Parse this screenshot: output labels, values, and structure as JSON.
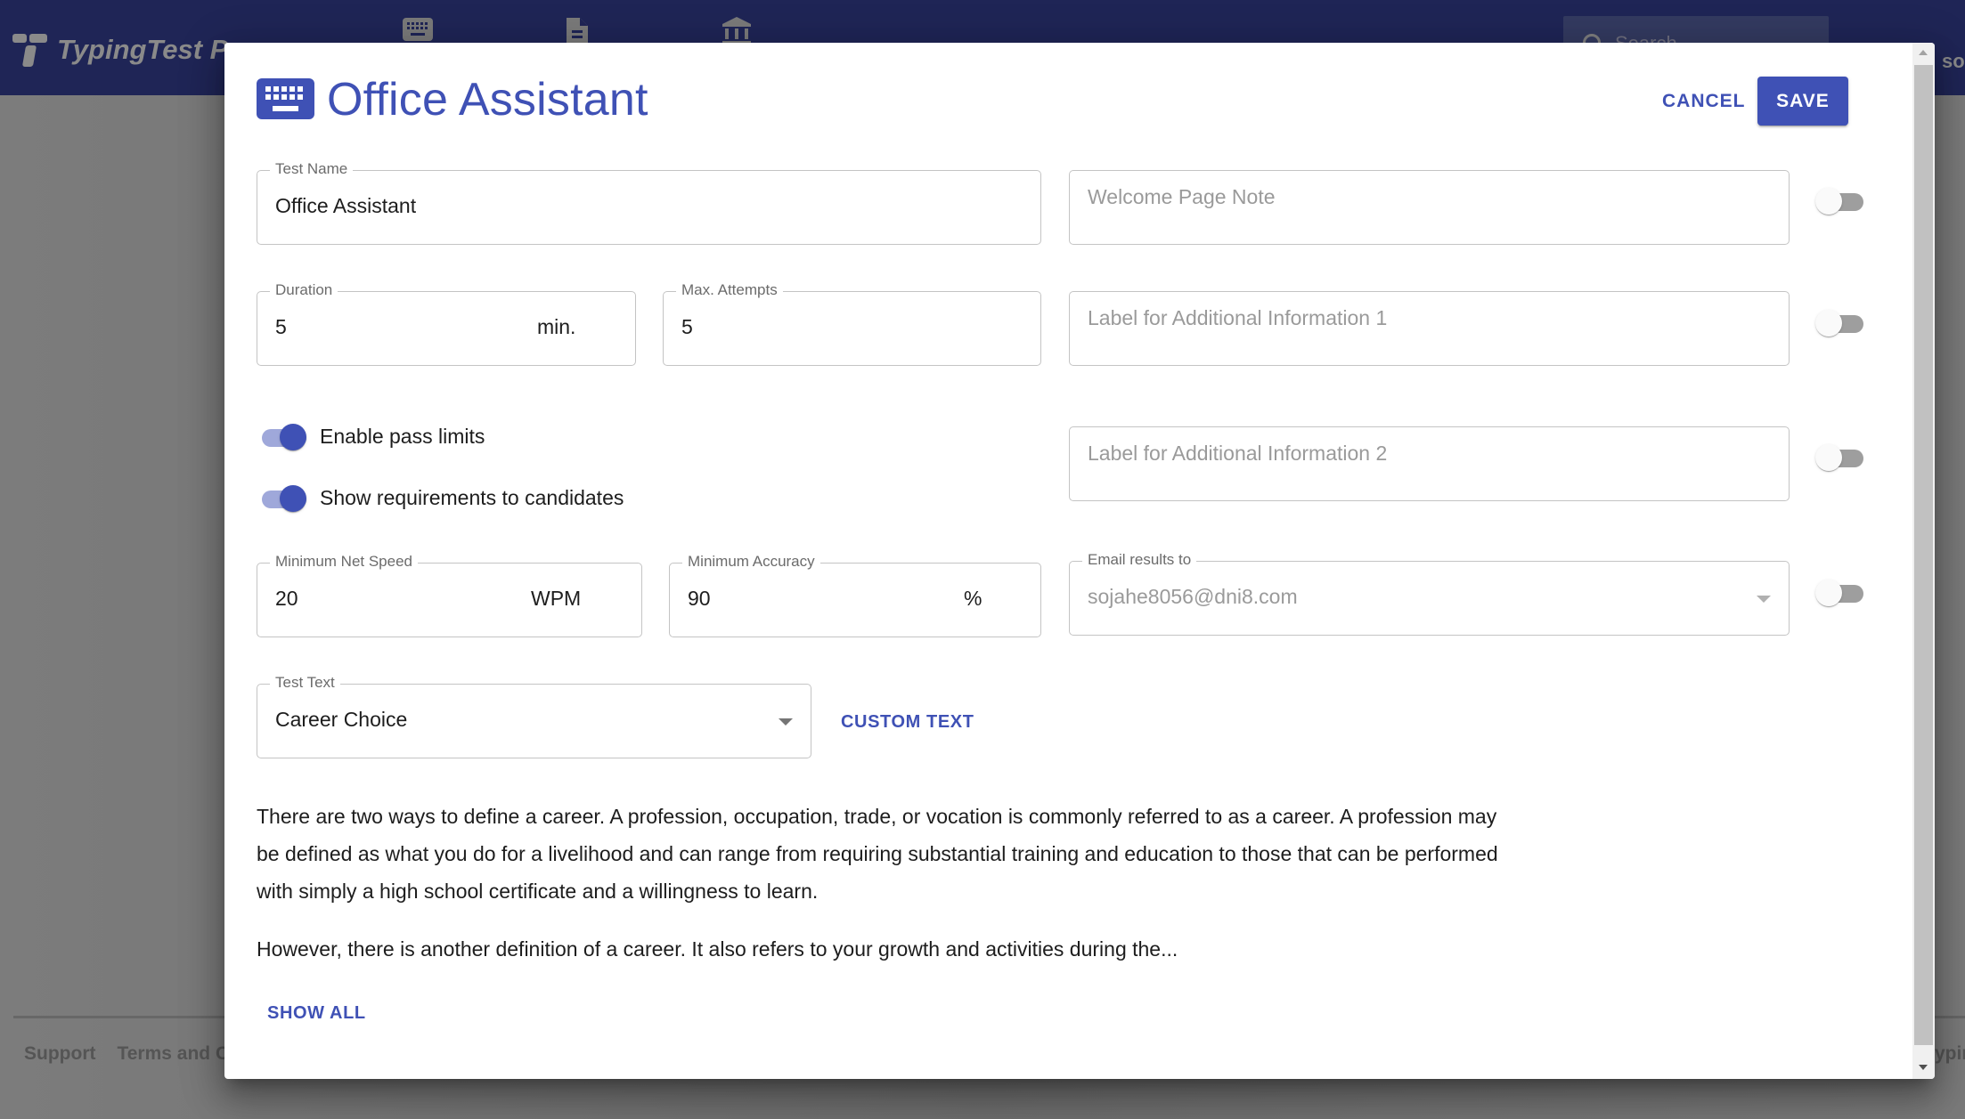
{
  "app": {
    "name": "TypingTest Pro",
    "search_placeholder": "Search",
    "user_name_fragment": "so",
    "nav_icons": [
      "keyboard-icon",
      "document-icon",
      "institution-icon"
    ],
    "footer": {
      "links": [
        "Support",
        "Terms and Conditions"
      ],
      "copyright_fragment": "ypin"
    }
  },
  "modal": {
    "title": "Office Assistant",
    "title_icon": "keyboard-icon",
    "cancel_label": "CANCEL",
    "save_label": "SAVE",
    "fields": {
      "test_name": {
        "label": "Test Name",
        "value": "Office Assistant"
      },
      "duration": {
        "label": "Duration",
        "value": "5",
        "suffix": "min."
      },
      "max_attempts": {
        "label": "Max. Attempts",
        "value": "5"
      },
      "min_net_speed": {
        "label": "Minimum Net Speed",
        "value": "20",
        "suffix": "WPM"
      },
      "min_accuracy": {
        "label": "Minimum Accuracy",
        "value": "90",
        "suffix": "%"
      },
      "welcome_note": {
        "placeholder": "Welcome Page Note",
        "enabled": false
      },
      "additional_info_1": {
        "placeholder": "Label for Additional Information 1",
        "enabled": false
      },
      "additional_info_2": {
        "placeholder": "Label for Additional Information 2",
        "enabled": false
      },
      "email_results": {
        "label": "Email results to",
        "value": "sojahe8056@dni8.com",
        "enabled": false
      },
      "test_text": {
        "label": "Test Text",
        "value": "Career Choice"
      }
    },
    "switches": {
      "enable_pass_limits": {
        "label": "Enable pass limits",
        "on": true
      },
      "show_requirements": {
        "label": "Show requirements to candidates",
        "on": true
      }
    },
    "custom_text_label": "CUSTOM TEXT",
    "preview_paragraphs": [
      "There are two ways to define a career. A profession, occupation, trade, or vocation is commonly referred to as a career. A profession may be defined as what you do for a livelihood and can range from requiring substantial training and education to those that can be performed with simply a high school certificate and a willingness to learn.",
      "However, there is another definition of a career. It also refers to your growth and activities during the..."
    ],
    "show_all_label": "SHOW ALL"
  },
  "colors": {
    "primary": "#3f51b5",
    "header_bg": "#1f2556",
    "overlay_bg": "#7a7a7a"
  }
}
